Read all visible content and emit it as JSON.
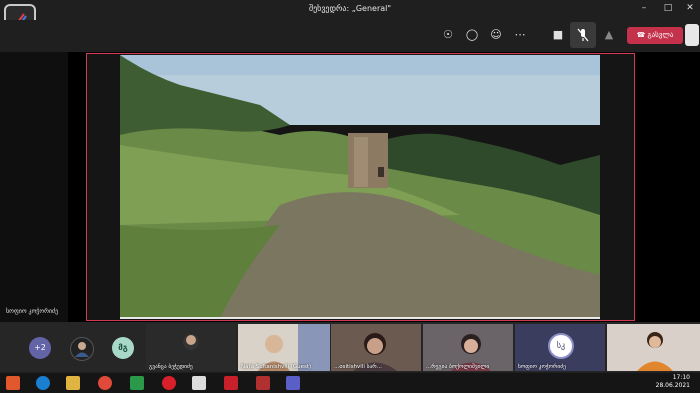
{
  "window": {
    "title": "შეხვედრა: „General\""
  },
  "controls": {
    "leave_label": "გასვლა"
  },
  "participants": {
    "main_name": "სოფიო კოჭორიძე",
    "overflow_count": "+2",
    "avatar_initials": "მგ",
    "tiles": [
      {
        "name": "გვანცა ბეჭედიძე"
      },
      {
        "name": "Nata Sultanishvili (Guest)"
      },
      {
        "name": "...ositishvili სარ..."
      },
      {
        "name": "...რეგია ბოქოლიშვილი"
      },
      {
        "name": "სოფიო კოჭორიძე"
      },
      {
        "name": ""
      }
    ],
    "self_initials": "სკ"
  },
  "clock": {
    "time": "17:10",
    "date": "28.06.2021"
  },
  "colors": {
    "leave": "#c4314b",
    "share_border": "#d23a4f",
    "avatar_green": "#a8d8c8",
    "avatar_purple": "#6264a7"
  }
}
